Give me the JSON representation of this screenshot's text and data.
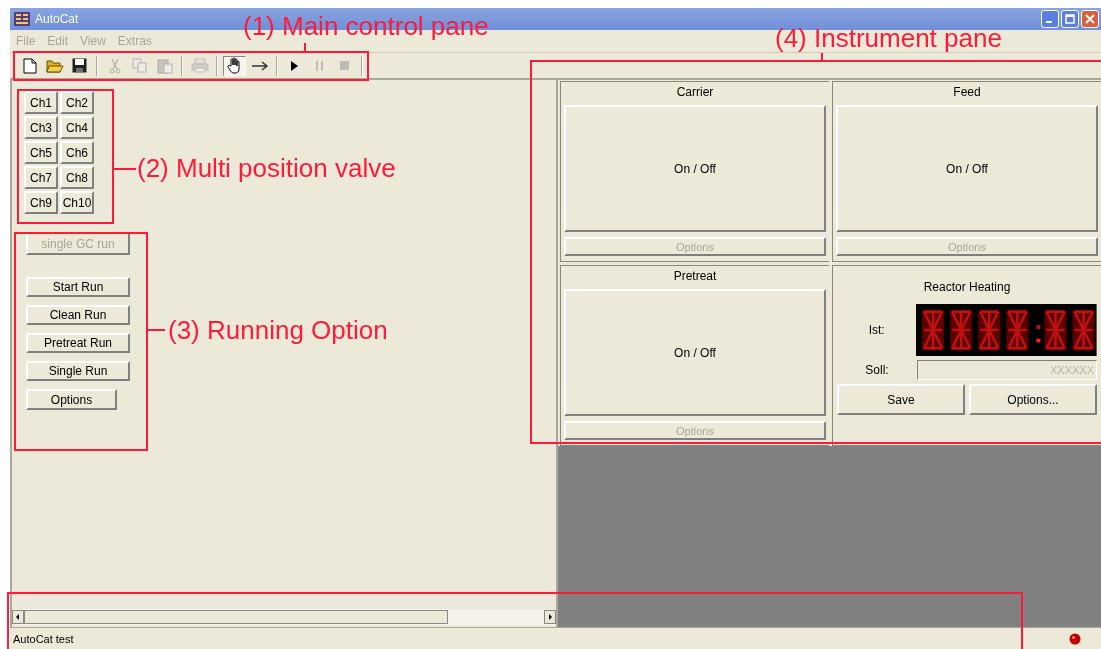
{
  "window": {
    "title": "AutoCat"
  },
  "menu": [
    {
      "label": "File",
      "disabled": true
    },
    {
      "label": "Edit",
      "disabled": true
    },
    {
      "label": "View",
      "disabled": true
    },
    {
      "label": "Extras",
      "disabled": true
    }
  ],
  "toolbar_groups": [
    [
      {
        "kind": "new",
        "disabled": false,
        "pressed": false
      },
      {
        "kind": "open",
        "disabled": false,
        "pressed": false
      },
      {
        "kind": "save",
        "disabled": false,
        "pressed": false
      }
    ],
    [
      {
        "kind": "cut",
        "disabled": true,
        "pressed": false
      },
      {
        "kind": "copy",
        "disabled": true,
        "pressed": false
      },
      {
        "kind": "paste",
        "disabled": true,
        "pressed": false
      }
    ],
    [
      {
        "kind": "print",
        "disabled": true,
        "pressed": false
      }
    ],
    [
      {
        "kind": "hand",
        "disabled": false,
        "pressed": true
      },
      {
        "kind": "arrow",
        "disabled": false,
        "pressed": false
      }
    ],
    [
      {
        "kind": "play",
        "disabled": false,
        "pressed": false
      },
      {
        "kind": "pause",
        "disabled": true,
        "pressed": false
      },
      {
        "kind": "stop",
        "disabled": true,
        "pressed": false
      }
    ]
  ],
  "valve_channels": [
    {
      "label": "Ch1"
    },
    {
      "label": "Ch2"
    },
    {
      "label": "Ch3"
    },
    {
      "label": "Ch4"
    },
    {
      "label": "Ch5"
    },
    {
      "label": "Ch6"
    },
    {
      "label": "Ch7"
    },
    {
      "label": "Ch8"
    },
    {
      "label": "Ch9"
    },
    {
      "label": "Ch10"
    }
  ],
  "run_buttons": [
    {
      "label": "single GC run",
      "disabled": true
    },
    {
      "label": "Start Run",
      "disabled": false
    },
    {
      "label": "Clean Run",
      "disabled": false
    },
    {
      "label": "Pretreat Run",
      "disabled": false
    },
    {
      "label": "Single Run",
      "disabled": false
    },
    {
      "label": "Options",
      "disabled": false
    }
  ],
  "instruments": [
    {
      "kind": "switch",
      "title": "Carrier",
      "button": "On / Off",
      "options": "Options",
      "options_disabled": true
    },
    {
      "kind": "switch",
      "title": "Feed",
      "button": "On / Off",
      "options": "Options",
      "options_disabled": true
    },
    {
      "kind": "switch",
      "title": "Pretreat",
      "button": "On / Off",
      "options": "Options",
      "options_disabled": true
    },
    {
      "kind": "heater",
      "title": "Reactor Heating",
      "ist_label": "Ist:",
      "soll_label": "Soll:",
      "soll_placeholder": "XXXXXX",
      "buttons": [
        "Save",
        "Options..."
      ]
    }
  ],
  "status_bar": {
    "text": "AutoCat test"
  },
  "annotations": [
    {
      "kind": "labeled",
      "label": "(1) Main control pane"
    },
    {
      "kind": "labeled",
      "label": "(2) Multi position valve"
    },
    {
      "kind": "labeled",
      "label": "(3) Running Option"
    },
    {
      "kind": "labeled",
      "label": "(4) Instrument pane"
    },
    {
      "kind": "box"
    }
  ]
}
